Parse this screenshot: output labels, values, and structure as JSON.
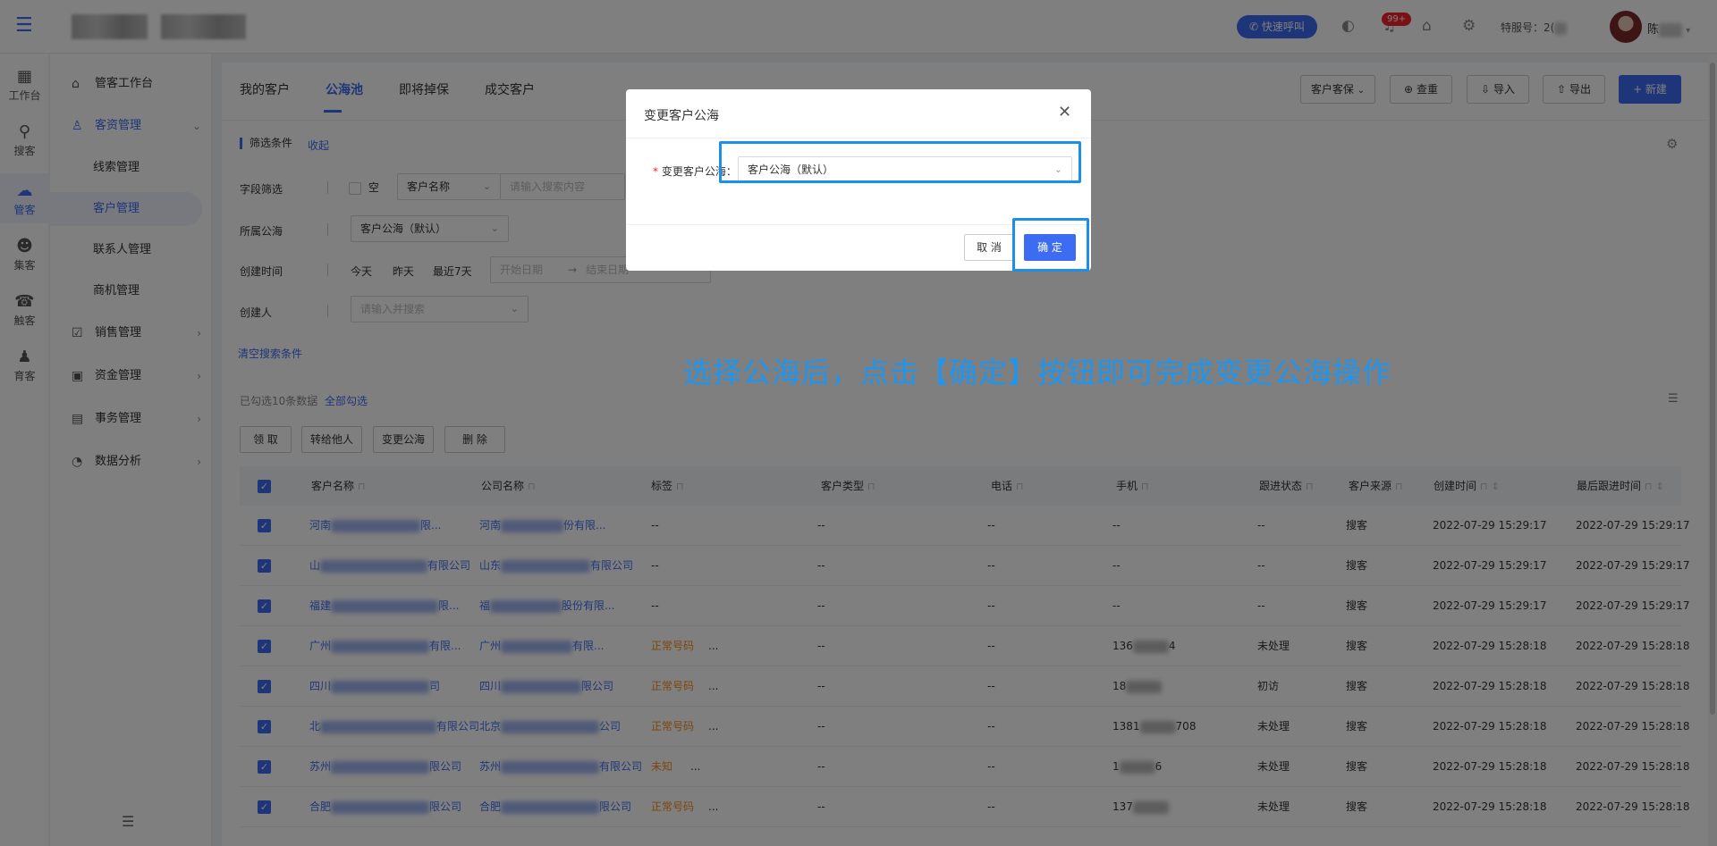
{
  "topbar": {
    "quick_call": "快速呼叫",
    "notification_badge": "99+",
    "service_number_label": "特服号：2(",
    "username": "陈"
  },
  "rail": [
    {
      "icon": "workbench-icon",
      "glyph": "▦",
      "label": "工作台"
    },
    {
      "icon": "search-customer-icon",
      "glyph": "⚲",
      "label": "搜客"
    },
    {
      "icon": "cloud-icon",
      "glyph": "☁",
      "label": "管客"
    },
    {
      "icon": "people-icon",
      "glyph": "☻",
      "label": "集客"
    },
    {
      "icon": "contact-icon",
      "glyph": "☎",
      "label": "触客"
    },
    {
      "icon": "nurture-icon",
      "glyph": "♟",
      "label": "育客"
    }
  ],
  "sidebar": [
    {
      "label": "管客工作台",
      "glyph": "⌂"
    },
    {
      "label": "客资管理",
      "glyph": "♙"
    },
    {
      "label": "线索管理"
    },
    {
      "label": "客户管理"
    },
    {
      "label": "联系人管理"
    },
    {
      "label": "商机管理"
    },
    {
      "label": "销售管理",
      "glyph": "☑"
    },
    {
      "label": "资金管理",
      "glyph": "▣"
    },
    {
      "label": "事务管理",
      "glyph": "▤"
    },
    {
      "label": "数据分析",
      "glyph": "◔"
    }
  ],
  "tabs": [
    "我的客户",
    "公海池",
    "即将掉保",
    "成交客户"
  ],
  "toolbar": {
    "protect": "客户客保",
    "dedupe": "查重",
    "import": "导入",
    "export": "导出",
    "create": "+ 新建"
  },
  "filter": {
    "title": "筛选条件",
    "collapse": "收起",
    "field_label": "字段筛选",
    "empty": "空",
    "field_select": "客户名称",
    "search_placeholder": "请输入搜索内容",
    "pool_label": "所属公海",
    "pool_value": "客户公海（默认）",
    "created_label": "创建时间",
    "today": "今天",
    "yesterday": "昨天",
    "last7": "最近7天",
    "start_placeholder": "开始日期",
    "arrow": "→",
    "end_placeholder": "结束日期",
    "creator_label": "创建人",
    "creator_placeholder": "请输入并搜索",
    "clear": "清空搜索条件"
  },
  "selection": {
    "info": "已勾选10条数据",
    "select_all": "全部勾选"
  },
  "actions": [
    "领 取",
    "转给他人",
    "变更公海",
    "删 除"
  ],
  "table": {
    "headers": [
      "客户名称",
      "公司名称",
      "标签",
      "客户类型",
      "电话",
      "手机",
      "跟进状态",
      "客户来源",
      "创建时间",
      "最后跟进时间"
    ],
    "rows": [
      {
        "name_pre": "河南",
        "name_suf": "限...",
        "company_pre": "河南",
        "company_suf": "份有限...",
        "tag": "--",
        "tag_more": "",
        "type": "--",
        "phone": "--",
        "mobile_pre": "--",
        "mobile_suf": "",
        "status": "--",
        "source": "搜客",
        "created": "2022-07-29 15:29:17",
        "last": "2022-07-29 15:29:17"
      },
      {
        "name_pre": "山",
        "name_suf": "有限公司",
        "company_pre": "山东",
        "company_suf": "有限公司",
        "tag": "--",
        "tag_more": "",
        "type": "--",
        "phone": "--",
        "mobile_pre": "--",
        "mobile_suf": "",
        "status": "--",
        "source": "搜客",
        "created": "2022-07-29 15:29:17",
        "last": "2022-07-29 15:29:17"
      },
      {
        "name_pre": "福建",
        "name_suf": "限...",
        "company_pre": "福",
        "company_suf": "股份有限...",
        "tag": "--",
        "tag_more": "",
        "type": "--",
        "phone": "--",
        "mobile_pre": "--",
        "mobile_suf": "",
        "status": "--",
        "source": "搜客",
        "created": "2022-07-29 15:29:17",
        "last": "2022-07-29 15:29:17"
      },
      {
        "name_pre": "广州",
        "name_suf": "有限...",
        "company_pre": "广州",
        "company_suf": "有限...",
        "tag": "正常号码",
        "tag_more": "...",
        "type": "--",
        "phone": "--",
        "mobile_pre": "136",
        "mobile_suf": "4",
        "status": "未处理",
        "source": "搜客",
        "created": "2022-07-29 15:28:18",
        "last": "2022-07-29 15:28:18"
      },
      {
        "name_pre": "四川",
        "name_suf": "司",
        "company_pre": "四川",
        "company_suf": "限公司",
        "tag": "正常号码",
        "tag_more": "...",
        "type": "--",
        "phone": "--",
        "mobile_pre": "18",
        "mobile_suf": "",
        "status": "初访",
        "source": "搜客",
        "created": "2022-07-29 15:28:18",
        "last": "2022-07-29 15:28:18"
      },
      {
        "name_pre": "北",
        "name_suf": "有限公司",
        "company_pre": "北京",
        "company_suf": "公司",
        "tag": "正常号码",
        "tag_more": "...",
        "type": "--",
        "phone": "--",
        "mobile_pre": "1381",
        "mobile_suf": "708",
        "status": "未处理",
        "source": "搜客",
        "created": "2022-07-29 15:28:18",
        "last": "2022-07-29 15:28:18"
      },
      {
        "name_pre": "苏州",
        "name_suf": "限公司",
        "company_pre": "苏州",
        "company_suf": "有限公司",
        "tag": "未知",
        "tag_more": "...",
        "type": "--",
        "phone": "--",
        "mobile_pre": "1",
        "mobile_suf": "6",
        "status": "未处理",
        "source": "搜客",
        "created": "2022-07-29 15:28:18",
        "last": "2022-07-29 15:28:18"
      },
      {
        "name_pre": "合肥",
        "name_suf": "限公司",
        "company_pre": "合肥",
        "company_suf": "限公司",
        "tag": "正常号码",
        "tag_more": "...",
        "type": "--",
        "phone": "--",
        "mobile_pre": "137",
        "mobile_suf": "",
        "status": "未处理",
        "source": "搜客",
        "created": "2022-07-29 15:28:18",
        "last": "2022-07-29 15:28:18"
      }
    ]
  },
  "modal": {
    "title": "变更客户公海",
    "required_mark": "*",
    "field_label": "变更客户公海：",
    "selected_value": "客户公海（默认）",
    "cancel": "取 消",
    "confirm": "确 定"
  },
  "annotation": "选择公海后，点击【确定】按钮即可完成变更公海操作",
  "colors": {
    "accent": "#3d6cf2",
    "highlight": "#1c8fe8",
    "annotation": "#1e96f0",
    "tag": "#fa8c16"
  }
}
